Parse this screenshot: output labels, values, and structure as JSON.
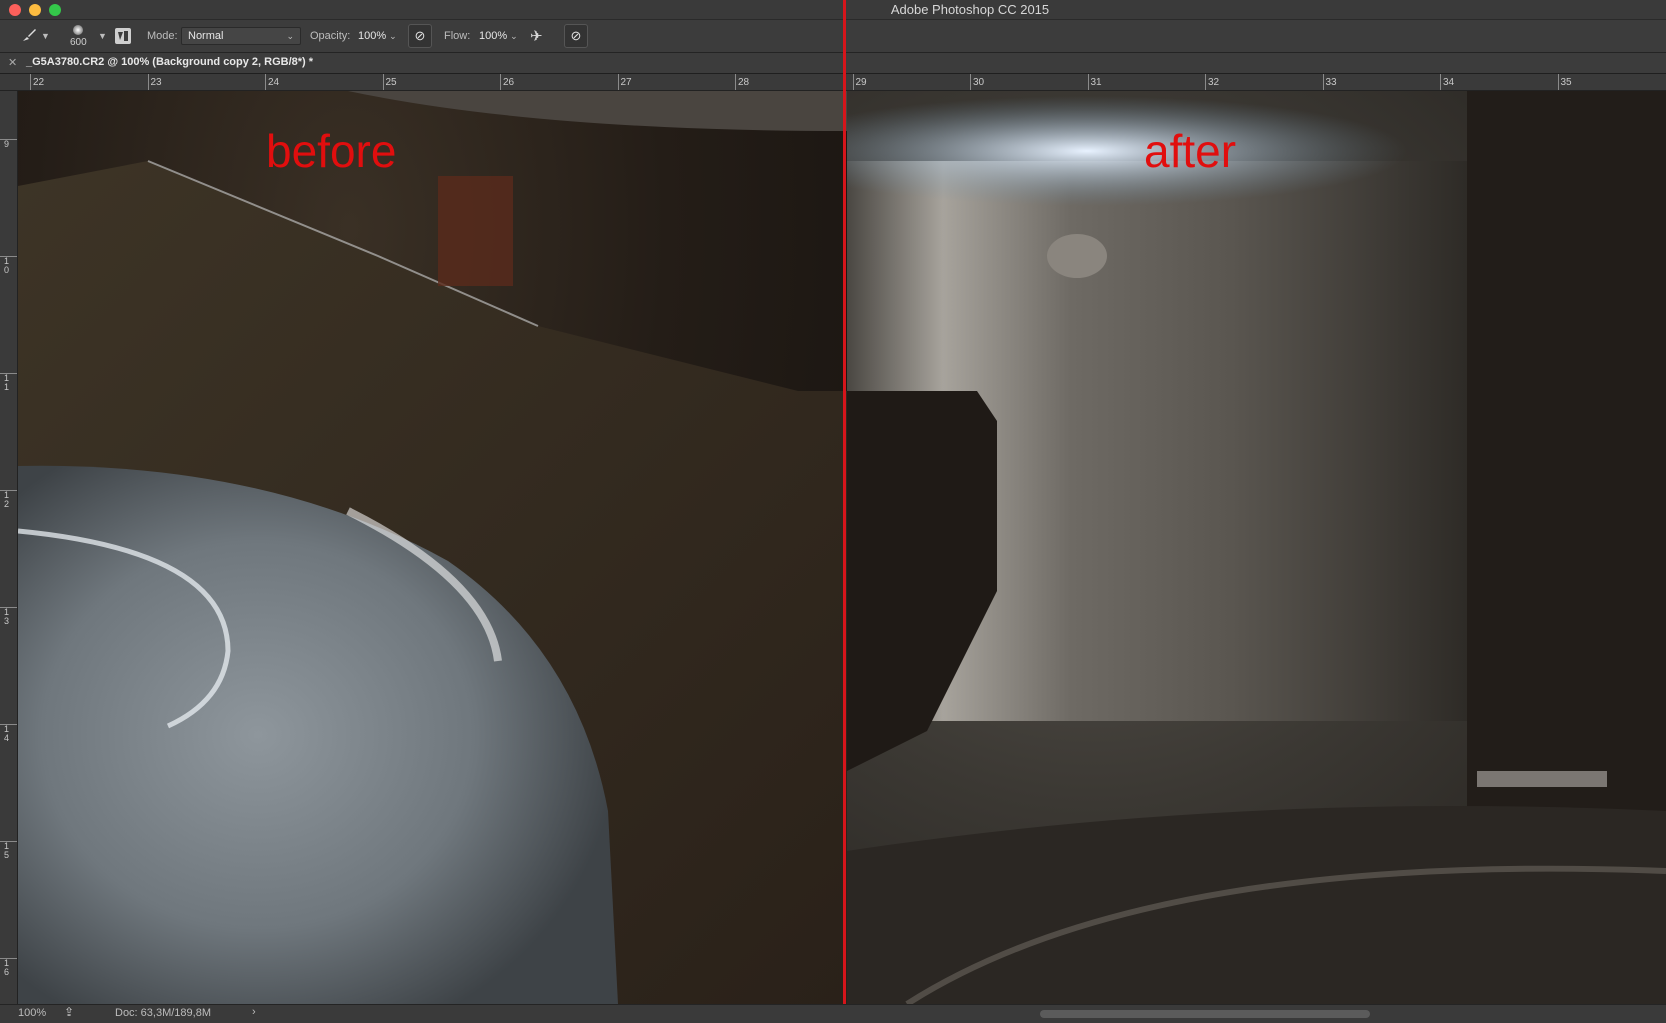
{
  "app": {
    "title": "Adobe Photoshop CC 2015"
  },
  "options_bar": {
    "brush_size": "600",
    "mode_label": "Mode:",
    "mode_value": "Normal",
    "opacity_label": "Opacity:",
    "opacity_value": "100%",
    "flow_label": "Flow:",
    "flow_value": "100%"
  },
  "document": {
    "tab_title": "_G5A3780.CR2 @ 100% (Background copy 2, RGB/8*) *"
  },
  "rulers": {
    "horizontal": [
      "22",
      "23",
      "24",
      "25",
      "26",
      "27",
      "28",
      "29",
      "30",
      "31",
      "32",
      "33",
      "34",
      "35"
    ],
    "vertical": [
      "9",
      "1 0",
      "1 1",
      "1 2",
      "1 3",
      "1 4",
      "1 5",
      "1 6"
    ]
  },
  "captions": {
    "before": "before",
    "after": "after"
  },
  "status": {
    "zoom": "100%",
    "doc_info": "Doc: 63,3M/189,8M"
  },
  "colors": {
    "caption_red": "#e10e0e",
    "divider_red": "#d6151b"
  }
}
